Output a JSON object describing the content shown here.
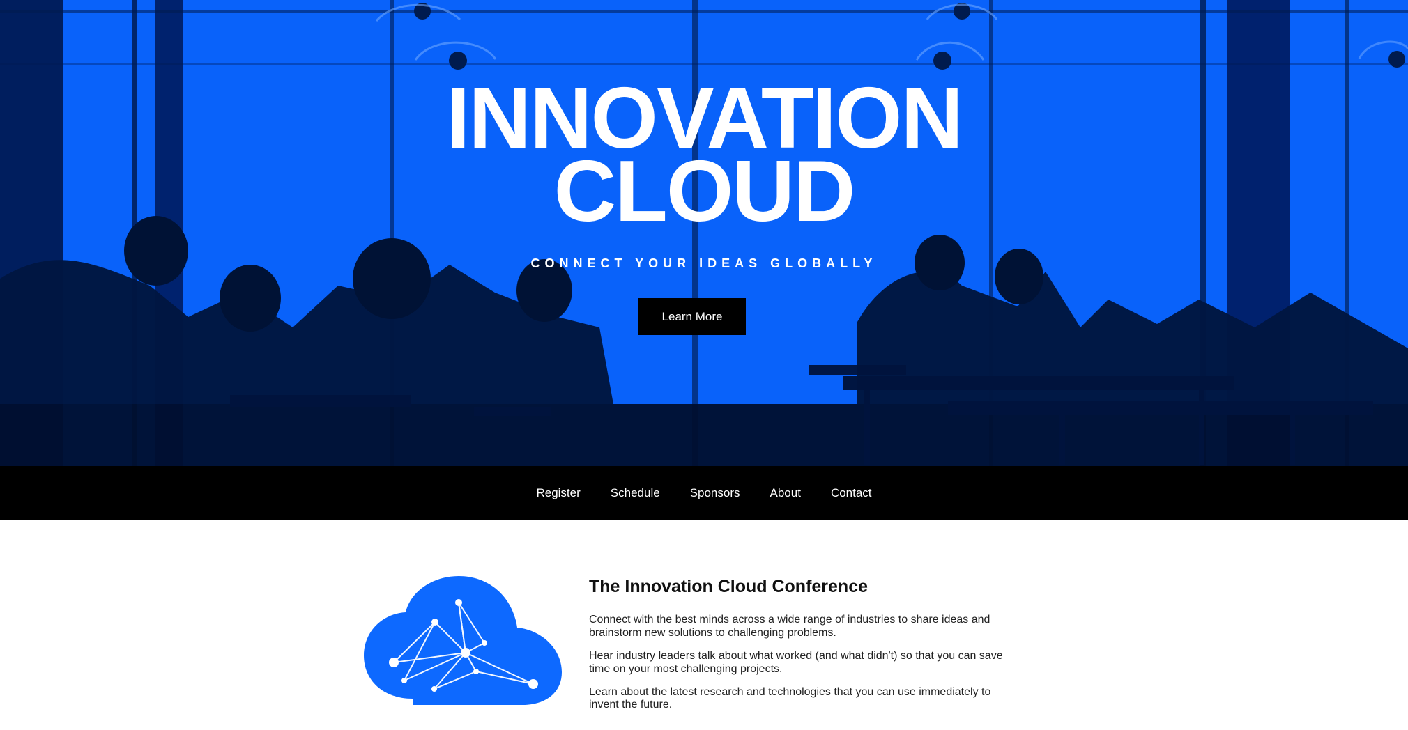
{
  "hero": {
    "title_line_1": "INNOVATION",
    "title_line_2": "CLOUD",
    "tagline": "CONNECT YOUR IDEAS GLOBALLY",
    "button_label": "Learn More",
    "background_color": "#0d69ff"
  },
  "nav": {
    "items": [
      {
        "label": "Register"
      },
      {
        "label": "Schedule"
      },
      {
        "label": "Sponsors"
      },
      {
        "label": "About"
      },
      {
        "label": "Contact"
      }
    ]
  },
  "content": {
    "title": "The Innovation Cloud Conference",
    "paragraphs": [
      "Connect with the best minds across a wide range of industries to share ideas and brainstorm new solutions to challenging problems.",
      "Hear industry leaders talk about what worked (and what didn't) so that you can save time on your most challenging projects.",
      "Learn about the latest research and technologies that you can use immediately to invent the future."
    ],
    "cloud_icon": "cloud-network-icon",
    "cloud_color": "#0d69ff"
  }
}
